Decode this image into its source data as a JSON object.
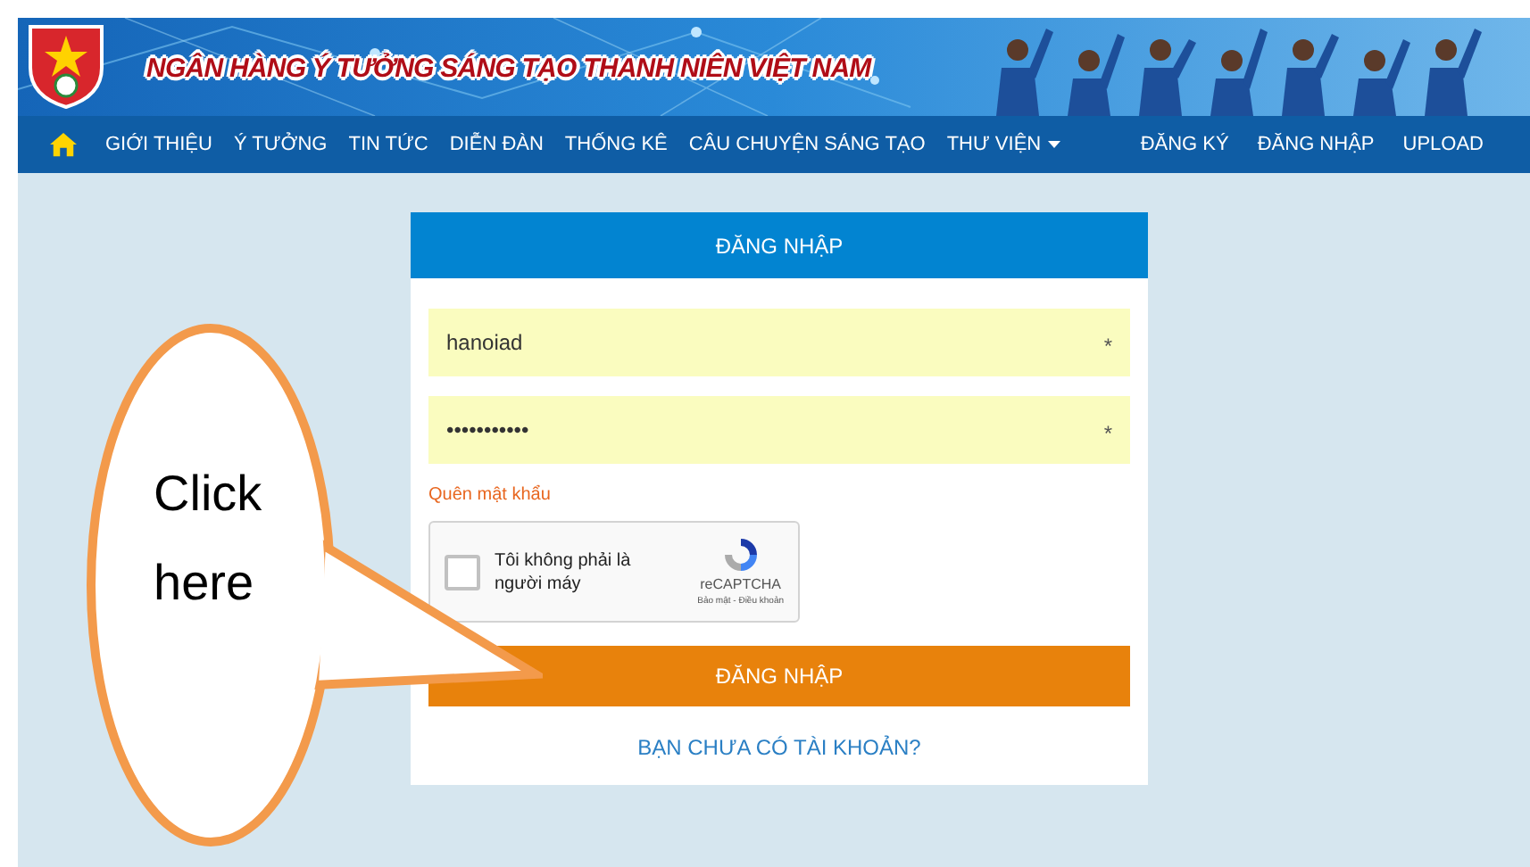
{
  "banner": {
    "title": "NGÂN HÀNG Ý TƯỞNG SÁNG TẠO THANH NIÊN VIỆT NAM"
  },
  "nav": {
    "left": [
      {
        "label": "GIỚI THIỆU",
        "dropdown": false
      },
      {
        "label": "Ý TƯỞNG",
        "dropdown": false
      },
      {
        "label": "TIN TỨC",
        "dropdown": false
      },
      {
        "label": "DIỄN ĐÀN",
        "dropdown": false
      },
      {
        "label": "THỐNG KÊ",
        "dropdown": false
      },
      {
        "label": "CÂU CHUYỆN SÁNG TẠO",
        "dropdown": false
      },
      {
        "label": "THƯ VIỆN",
        "dropdown": true
      }
    ],
    "right": [
      {
        "label": "ĐĂNG KÝ"
      },
      {
        "label": "ĐĂNG NHẬP"
      },
      {
        "label": "UPLOAD"
      }
    ]
  },
  "login": {
    "title": "ĐĂNG NHẬP",
    "fields": [
      {
        "value": "hanoiad",
        "required_mark": "*"
      },
      {
        "value": "•••••••••••",
        "required_mark": "*"
      }
    ],
    "forgot_link": "Quên mật khẩu",
    "captcha": {
      "label": "Tôi không phải là người máy",
      "checked": false,
      "brand": "reCAPTCHA",
      "terms": "Bảo mật - Điều khoản"
    },
    "submit": "ĐĂNG NHẬP",
    "register_link": "BẠN CHƯA CÓ TÀI KHOẢN?"
  },
  "callout": {
    "text": "Click here"
  }
}
